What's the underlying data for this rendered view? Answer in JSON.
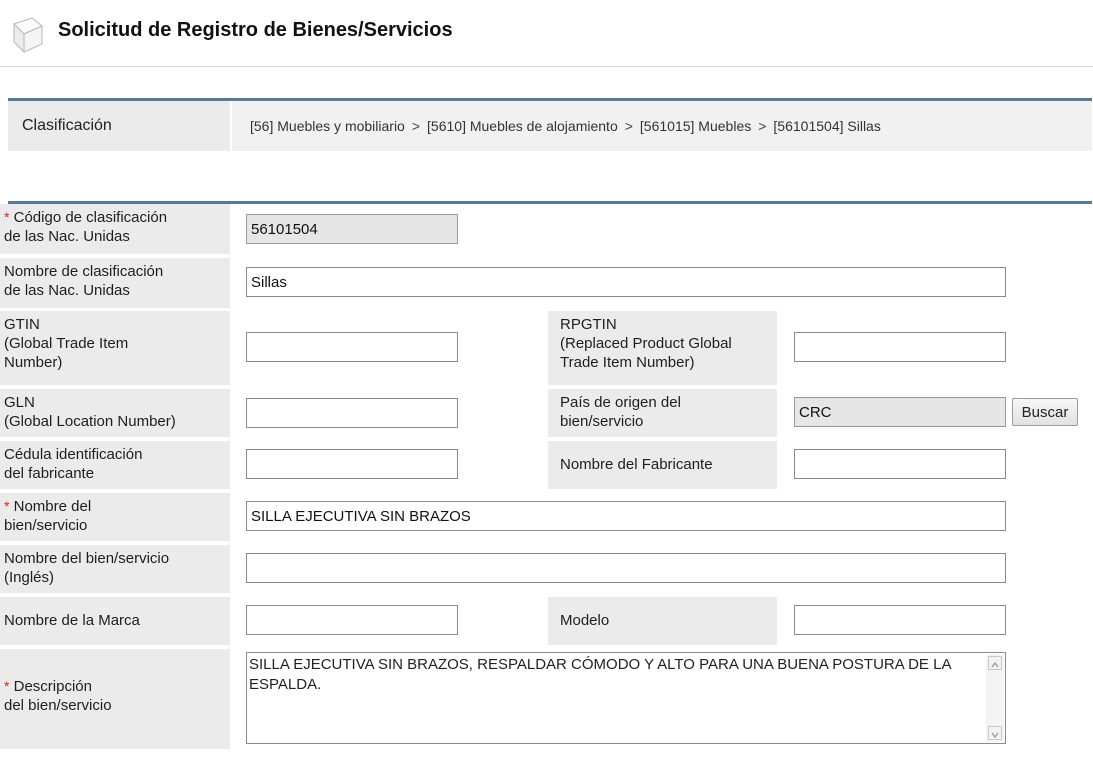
{
  "page": {
    "title": "Solicitud de Registro de Bienes/Servicios",
    "title_icon": "document-icon"
  },
  "classification": {
    "label": "Clasificación",
    "separator": ">",
    "path": [
      "[56] Muebles y mobiliario",
      "[5610] Muebles de alojamiento",
      "[561015] Muebles",
      "[56101504] Sillas"
    ]
  },
  "form": {
    "required_mark": "*",
    "unspsc_code": {
      "label_line1": "Código de clasificación",
      "label_line2": "de las Nac. Unidas",
      "value": "56101504"
    },
    "unspsc_name": {
      "label_line1": "Nombre de clasificación",
      "label_line2": "de las Nac. Unidas",
      "value": "Sillas"
    },
    "gtin": {
      "label_line1": "GTIN",
      "label_line2": "(Global Trade Item",
      "label_line3": "Number)",
      "value": ""
    },
    "rpgtin": {
      "label_line1": "RPGTIN",
      "label_line2": "(Replaced Product Global",
      "label_line3": "Trade Item Number)",
      "value": ""
    },
    "gln": {
      "label_line1": "GLN",
      "label_line2": "(Global Location Number)",
      "value": ""
    },
    "country": {
      "label_line1": "País de origen del",
      "label_line2": "bien/servicio",
      "value": "CRC",
      "button": "Buscar"
    },
    "manufacturer_id": {
      "label_line1": "Cédula identificación",
      "label_line2": "del fabricante",
      "value": ""
    },
    "manufacturer_name": {
      "label": "Nombre del Fabricante",
      "value": ""
    },
    "item_name": {
      "label_line1": "Nombre del",
      "label_line2": "bien/servicio",
      "value": "SILLA EJECUTIVA SIN BRAZOS"
    },
    "item_name_en": {
      "label_line1": "Nombre del bien/servicio",
      "label_line2": "(Inglés)",
      "value": ""
    },
    "brand": {
      "label": "Nombre de la Marca",
      "value": ""
    },
    "model": {
      "label": "Modelo",
      "value": ""
    },
    "description": {
      "label_line1": "Descripción",
      "label_line2": "del bien/servicio",
      "value": "SILLA EJECUTIVA SIN BRAZOS, RESPALDAR CÓMODO Y ALTO PARA UNA BUENA POSTURA DE LA ESPALDA."
    }
  }
}
